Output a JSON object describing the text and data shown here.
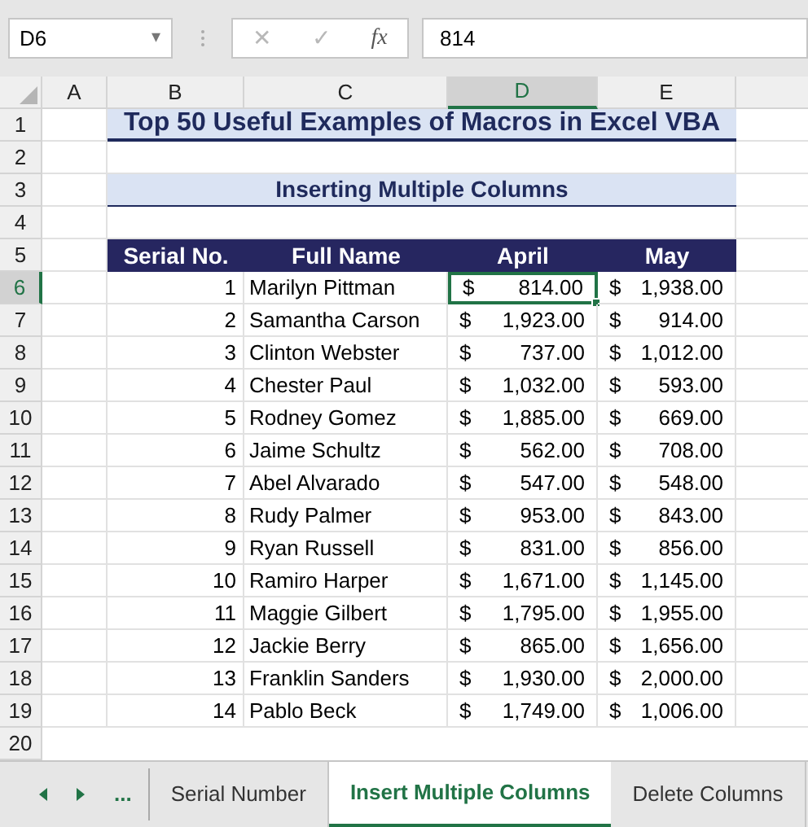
{
  "name_box": {
    "value": "D6",
    "dropdown": "▾"
  },
  "formula_bar": {
    "cancel": "✕",
    "enter": "✓",
    "fx": "fx",
    "value": "814"
  },
  "columns": [
    {
      "label": "A",
      "selected": false
    },
    {
      "label": "B",
      "selected": false
    },
    {
      "label": "C",
      "selected": false
    },
    {
      "label": "D",
      "selected": true
    },
    {
      "label": "E",
      "selected": false
    }
  ],
  "row_numbers": [
    {
      "label": "1",
      "selected": false
    },
    {
      "label": "2",
      "selected": false
    },
    {
      "label": "3",
      "selected": false
    },
    {
      "label": "4",
      "selected": false
    },
    {
      "label": "5",
      "selected": false
    },
    {
      "label": "6",
      "selected": true
    },
    {
      "label": "7",
      "selected": false
    },
    {
      "label": "8",
      "selected": false
    },
    {
      "label": "9",
      "selected": false
    },
    {
      "label": "10",
      "selected": false
    },
    {
      "label": "11",
      "selected": false
    },
    {
      "label": "12",
      "selected": false
    },
    {
      "label": "13",
      "selected": false
    },
    {
      "label": "14",
      "selected": false
    },
    {
      "label": "15",
      "selected": false
    },
    {
      "label": "16",
      "selected": false
    },
    {
      "label": "17",
      "selected": false
    },
    {
      "label": "18",
      "selected": false
    },
    {
      "label": "19",
      "selected": false
    },
    {
      "label": "20",
      "selected": false
    }
  ],
  "title": "Top 50 Useful Examples of Macros in Excel VBA",
  "subtitle": "Inserting Multiple Columns",
  "table": {
    "headers": [
      "Serial No.",
      "Full Name",
      "April",
      "May"
    ],
    "rows": [
      {
        "serial": "1",
        "name": "Marilyn Pittman",
        "april": {
          "symbol": "$",
          "amount": "814.00",
          "selected": true
        },
        "may": {
          "symbol": "$",
          "amount": "1,938.00",
          "selected": false
        }
      },
      {
        "serial": "2",
        "name": "Samantha Carson",
        "april": {
          "symbol": "$",
          "amount": "1,923.00",
          "selected": false
        },
        "may": {
          "symbol": "$",
          "amount": "914.00",
          "selected": false
        }
      },
      {
        "serial": "3",
        "name": "Clinton Webster",
        "april": {
          "symbol": "$",
          "amount": "737.00",
          "selected": false
        },
        "may": {
          "symbol": "$",
          "amount": "1,012.00",
          "selected": false
        }
      },
      {
        "serial": "4",
        "name": "Chester Paul",
        "april": {
          "symbol": "$",
          "amount": "1,032.00",
          "selected": false
        },
        "may": {
          "symbol": "$",
          "amount": "593.00",
          "selected": false
        }
      },
      {
        "serial": "5",
        "name": "Rodney Gomez",
        "april": {
          "symbol": "$",
          "amount": "1,885.00",
          "selected": false
        },
        "may": {
          "symbol": "$",
          "amount": "669.00",
          "selected": false
        }
      },
      {
        "serial": "6",
        "name": "Jaime Schultz",
        "april": {
          "symbol": "$",
          "amount": "562.00",
          "selected": false
        },
        "may": {
          "symbol": "$",
          "amount": "708.00",
          "selected": false
        }
      },
      {
        "serial": "7",
        "name": "Abel Alvarado",
        "april": {
          "symbol": "$",
          "amount": "547.00",
          "selected": false
        },
        "may": {
          "symbol": "$",
          "amount": "548.00",
          "selected": false
        }
      },
      {
        "serial": "8",
        "name": "Rudy Palmer",
        "april": {
          "symbol": "$",
          "amount": "953.00",
          "selected": false
        },
        "may": {
          "symbol": "$",
          "amount": "843.00",
          "selected": false
        }
      },
      {
        "serial": "9",
        "name": "Ryan Russell",
        "april": {
          "symbol": "$",
          "amount": "831.00",
          "selected": false
        },
        "may": {
          "symbol": "$",
          "amount": "856.00",
          "selected": false
        }
      },
      {
        "serial": "10",
        "name": "Ramiro Harper",
        "april": {
          "symbol": "$",
          "amount": "1,671.00",
          "selected": false
        },
        "may": {
          "symbol": "$",
          "amount": "1,145.00",
          "selected": false
        }
      },
      {
        "serial": "11",
        "name": "Maggie Gilbert",
        "april": {
          "symbol": "$",
          "amount": "1,795.00",
          "selected": false
        },
        "may": {
          "symbol": "$",
          "amount": "1,955.00",
          "selected": false
        }
      },
      {
        "serial": "12",
        "name": "Jackie Berry",
        "april": {
          "symbol": "$",
          "amount": "865.00",
          "selected": false
        },
        "may": {
          "symbol": "$",
          "amount": "1,656.00",
          "selected": false
        }
      },
      {
        "serial": "13",
        "name": "Franklin Sanders",
        "april": {
          "symbol": "$",
          "amount": "1,930.00",
          "selected": false
        },
        "may": {
          "symbol": "$",
          "amount": "2,000.00",
          "selected": false
        }
      },
      {
        "serial": "14",
        "name": "Pablo Beck",
        "april": {
          "symbol": "$",
          "amount": "1,749.00",
          "selected": false
        },
        "may": {
          "symbol": "$",
          "amount": "1,006.00",
          "selected": false
        }
      }
    ]
  },
  "sheet_tabs": {
    "more": "...",
    "tabs": [
      {
        "label": "Serial Number",
        "selected": false
      },
      {
        "label": "Insert Multiple Columns",
        "selected": true
      },
      {
        "label": "Delete Columns",
        "selected": false
      }
    ]
  }
}
